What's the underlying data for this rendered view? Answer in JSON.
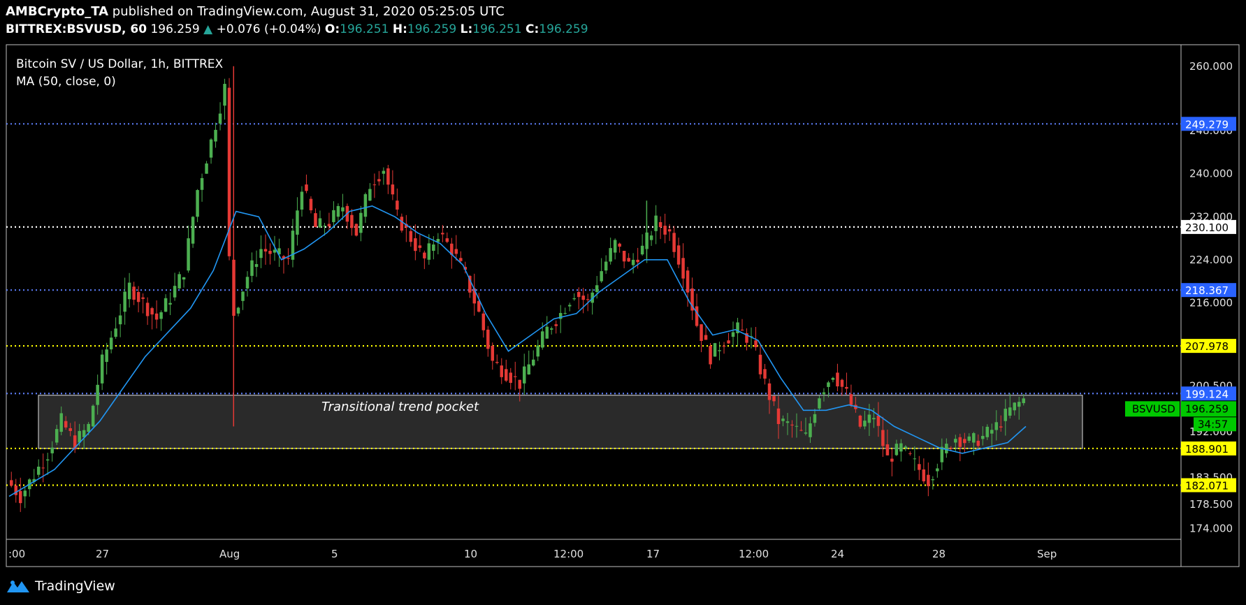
{
  "header": {
    "author": "AMBCrypto_TA",
    "published": "published on TradingView.com, August 31, 2020 05:25:05 UTC",
    "symbol": "BITTREX:BSVUSD, 60",
    "last": "196.259",
    "change": "+0.076 (+0.04%)",
    "o_label": "O:",
    "o": "196.251",
    "h_label": "H:",
    "h": "196.259",
    "l_label": "L:",
    "l": "196.251",
    "c_label": "C:",
    "c": "196.259"
  },
  "footer": {
    "brand": "TradingView",
    "icon": "tradingview-logo-icon"
  },
  "colors": {
    "up": "#26a69a",
    "candle_up": "#4caf50",
    "candle_down": "#e53935",
    "ma": "#2196f3",
    "blue_level": "#5b7cf5",
    "yellow_level": "#ffff00"
  },
  "chart_data": {
    "type": "candlestick",
    "title": "Bitcoin SV / US Dollar, 1h, BITTREX",
    "indicator": "MA (50, close, 0)",
    "ylim": [
      172,
      264
    ],
    "x_ticks": [
      ":00",
      "27",
      "Aug",
      "5",
      "10",
      "12:00",
      "17",
      "12:00",
      "24",
      "28",
      "Sep"
    ],
    "y_ticks": [
      "260.000",
      "248.000",
      "240.000",
      "232.000",
      "224.000",
      "216.000",
      "208.000",
      "200.500",
      "192.000",
      "183.500",
      "178.500",
      "174.000"
    ],
    "price_path": [
      [
        0,
        183
      ],
      [
        3,
        180
      ],
      [
        6,
        184
      ],
      [
        9,
        188
      ],
      [
        12,
        194
      ],
      [
        15,
        190
      ],
      [
        18,
        193
      ],
      [
        21,
        205
      ],
      [
        24,
        212
      ],
      [
        27,
        219
      ],
      [
        30,
        216
      ],
      [
        33,
        213
      ],
      [
        36,
        217
      ],
      [
        39,
        222
      ],
      [
        42,
        237
      ],
      [
        45,
        246
      ],
      [
        48,
        256
      ],
      [
        49,
        224
      ],
      [
        50,
        214
      ],
      [
        53,
        221
      ],
      [
        56,
        226
      ],
      [
        59,
        225
      ],
      [
        62,
        224
      ],
      [
        65,
        238
      ],
      [
        68,
        230
      ],
      [
        71,
        231
      ],
      [
        74,
        234
      ],
      [
        77,
        229
      ],
      [
        80,
        238
      ],
      [
        83,
        241
      ],
      [
        86,
        232
      ],
      [
        89,
        228
      ],
      [
        92,
        224
      ],
      [
        95,
        229
      ],
      [
        98,
        226
      ],
      [
        101,
        221
      ],
      [
        104,
        214
      ],
      [
        107,
        205
      ],
      [
        110,
        203
      ],
      [
        113,
        201
      ],
      [
        116,
        206
      ],
      [
        119,
        211
      ],
      [
        122,
        214
      ],
      [
        125,
        218
      ],
      [
        128,
        216
      ],
      [
        131,
        222
      ],
      [
        134,
        227
      ],
      [
        137,
        223
      ],
      [
        140,
        226
      ],
      [
        143,
        231
      ],
      [
        146,
        229
      ],
      [
        149,
        222
      ],
      [
        152,
        212
      ],
      [
        155,
        206
      ],
      [
        158,
        209
      ],
      [
        161,
        211
      ],
      [
        164,
        209
      ],
      [
        167,
        201
      ],
      [
        170,
        194
      ],
      [
        173,
        193
      ],
      [
        176,
        191
      ],
      [
        179,
        199
      ],
      [
        182,
        203
      ],
      [
        185,
        199
      ],
      [
        188,
        193
      ],
      [
        191,
        195
      ],
      [
        194,
        187
      ],
      [
        197,
        189
      ],
      [
        200,
        186
      ],
      [
        203,
        183
      ],
      [
        206,
        188
      ],
      [
        209,
        191
      ],
      [
        212,
        190
      ],
      [
        215,
        191
      ],
      [
        218,
        193
      ],
      [
        221,
        196
      ],
      [
        224,
        198
      ]
    ],
    "ma_path": [
      [
        0,
        180
      ],
      [
        10,
        185
      ],
      [
        20,
        194
      ],
      [
        30,
        206
      ],
      [
        40,
        215
      ],
      [
        45,
        222
      ],
      [
        50,
        233
      ],
      [
        55,
        232
      ],
      [
        60,
        224
      ],
      [
        65,
        226
      ],
      [
        70,
        229
      ],
      [
        75,
        233
      ],
      [
        80,
        234
      ],
      [
        85,
        232
      ],
      [
        90,
        229
      ],
      [
        95,
        227
      ],
      [
        100,
        223
      ],
      [
        105,
        214
      ],
      [
        110,
        207
      ],
      [
        115,
        210
      ],
      [
        120,
        213
      ],
      [
        125,
        214
      ],
      [
        130,
        218
      ],
      [
        135,
        221
      ],
      [
        140,
        224
      ],
      [
        145,
        224
      ],
      [
        150,
        216
      ],
      [
        155,
        210
      ],
      [
        160,
        211
      ],
      [
        165,
        209
      ],
      [
        170,
        202
      ],
      [
        175,
        196
      ],
      [
        180,
        196
      ],
      [
        185,
        197
      ],
      [
        190,
        196
      ],
      [
        195,
        193
      ],
      [
        200,
        191
      ],
      [
        205,
        189
      ],
      [
        210,
        188
      ],
      [
        215,
        189
      ],
      [
        220,
        190
      ],
      [
        224,
        193
      ]
    ],
    "levels": [
      {
        "value": 249.279,
        "label": "249.279",
        "style": "blue"
      },
      {
        "value": 230.1,
        "label": "230.100",
        "style": "white"
      },
      {
        "value": 218.367,
        "label": "218.367",
        "style": "blue"
      },
      {
        "value": 207.978,
        "label": "207.978",
        "style": "yellow"
      },
      {
        "value": 199.124,
        "label": "199.124",
        "style": "blue"
      },
      {
        "value": 188.901,
        "label": "188.901",
        "style": "yellow"
      },
      {
        "value": 182.071,
        "label": "182.071",
        "style": "yellow"
      }
    ],
    "zone": {
      "label": "Transitional trend pocket",
      "low": 188.9,
      "high": 198.8
    },
    "current": {
      "symbol": "BSVUSD",
      "price": "196.259",
      "countdown": "34:57"
    }
  }
}
